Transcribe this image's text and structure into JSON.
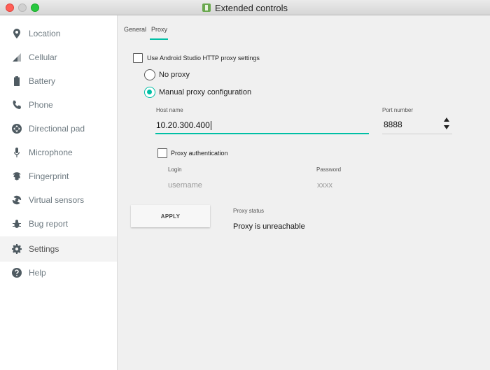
{
  "window": {
    "title": "Extended controls"
  },
  "sidebar": {
    "items": [
      {
        "label": "Location",
        "icon": "location-pin-icon"
      },
      {
        "label": "Cellular",
        "icon": "cellular-signal-icon"
      },
      {
        "label": "Battery",
        "icon": "battery-icon"
      },
      {
        "label": "Phone",
        "icon": "phone-icon"
      },
      {
        "label": "Directional pad",
        "icon": "dpad-icon"
      },
      {
        "label": "Microphone",
        "icon": "microphone-icon"
      },
      {
        "label": "Fingerprint",
        "icon": "fingerprint-icon"
      },
      {
        "label": "Virtual sensors",
        "icon": "rotation-icon"
      },
      {
        "label": "Bug report",
        "icon": "bug-icon"
      },
      {
        "label": "Settings",
        "icon": "gear-icon",
        "selected": true
      },
      {
        "label": "Help",
        "icon": "help-icon"
      }
    ]
  },
  "tabs": {
    "general": "General",
    "proxy": "Proxy",
    "active": "Proxy"
  },
  "proxy": {
    "use_studio_settings": {
      "label": "Use Android Studio HTTP proxy settings",
      "checked": false
    },
    "no_proxy": {
      "label": "No proxy",
      "selected": false
    },
    "manual": {
      "label": "Manual proxy configuration",
      "selected": true
    },
    "host": {
      "label": "Host name",
      "value": "10.20.300.400"
    },
    "port": {
      "label": "Port number",
      "value": "8888"
    },
    "auth": {
      "label": "Proxy authentication",
      "checked": false
    },
    "login": {
      "label": "Login",
      "placeholder": "username"
    },
    "password": {
      "label": "Password",
      "placeholder": "xxxx"
    },
    "apply_label": "APPLY",
    "status": {
      "label": "Proxy status",
      "value": "Proxy is unreachable"
    }
  },
  "colors": {
    "accent": "#00bfa5",
    "sidebar_bg": "#ffffff",
    "content_bg": "#f0f0f0"
  }
}
